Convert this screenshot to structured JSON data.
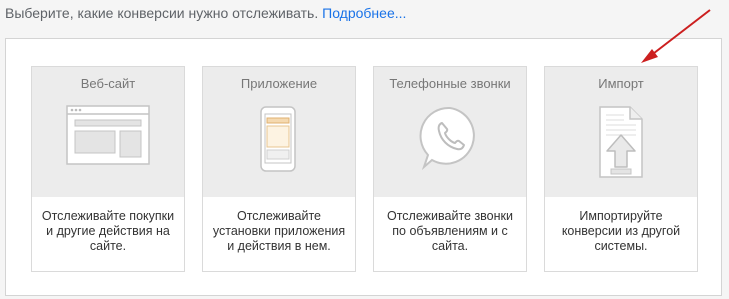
{
  "intro": {
    "text": "Выберите, какие конверсии нужно отслеживать.",
    "link": "Подробнее..."
  },
  "cards": [
    {
      "title": "Веб-сайт",
      "description": "Отслеживайте покупки и другие действия на сайте.",
      "icon": "website-icon"
    },
    {
      "title": "Приложение",
      "description": "Отслеживайте установки приложения и действия в нем.",
      "icon": "smartphone-icon"
    },
    {
      "title": "Телефонные звонки",
      "description": "Отслеживайте звонки по объявлениям и с сайта.",
      "icon": "phone-call-icon"
    },
    {
      "title": "Импорт",
      "description": "Импортируйте конверсии из другой системы.",
      "icon": "import-file-icon"
    }
  ],
  "colors": {
    "link": "#1a73e8",
    "annotation_arrow": "#cc1f1f",
    "card_header_bg": "#ececec"
  }
}
